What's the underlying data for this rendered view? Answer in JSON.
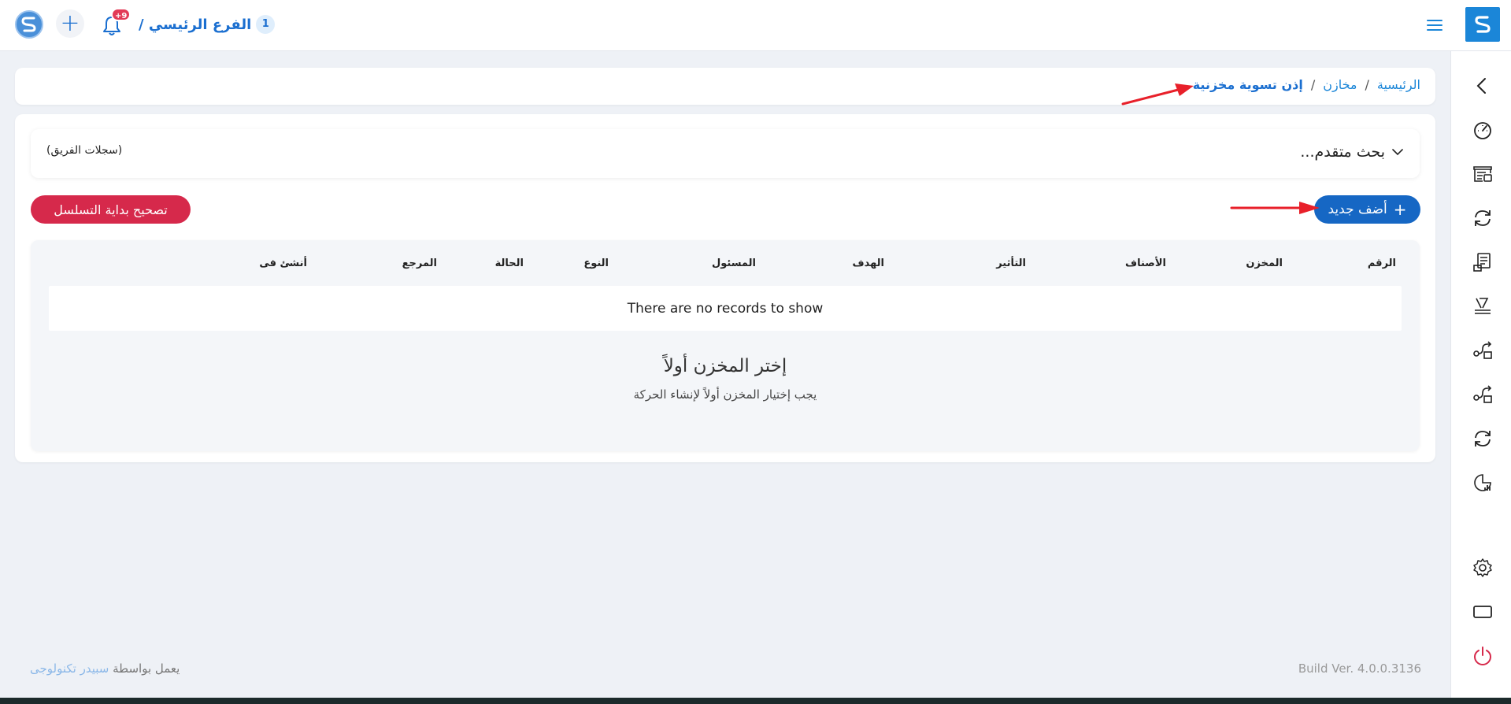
{
  "topbar": {
    "branch_name": "الفرع الرئيسي /",
    "branch_number": "1",
    "notification_badge": "+9",
    "brand_color": "#1b86d8"
  },
  "breadcrumb": {
    "home": "الرئيسية",
    "sep1": "/",
    "warehouses": "مخازن",
    "sep2": "/",
    "current": "إذن تسوية مخزنية"
  },
  "search": {
    "title": "بحث متقدم...",
    "team_records": "(سجلات الفريق)"
  },
  "actions": {
    "add_new": "أضف جديد",
    "fix_sequence": "تصحيح بداية التسلسل"
  },
  "table": {
    "headers": [
      "الرقم",
      "المخزن",
      "الأصناف",
      "التأثير",
      "الهدف",
      "المسئول",
      "النوع",
      "الحالة",
      "المرجع",
      "أنشئ فى"
    ],
    "empty_message": "There are no records to show"
  },
  "empty_state": {
    "title": "إختر المخزن أولاً",
    "subtitle": "يجب إختيار المخزن أولاً لإنشاء الحركة"
  },
  "footer": {
    "powered_by": "يعمل بواسطة",
    "company": "سبيدر تكنولوجى",
    "build": "Build Ver. 4.0.0.3136"
  },
  "sidebar_icons": [
    "chevron-left-icon",
    "dashboard-gauge-icon",
    "warehouse-icon",
    "refresh-icon",
    "inventory-report-icon",
    "adjustment-icon",
    "transfer-icon",
    "transfer-out-icon",
    "sync-icon",
    "stats-chart-icon",
    "gear-icon",
    "screen-icon",
    "power-icon"
  ]
}
